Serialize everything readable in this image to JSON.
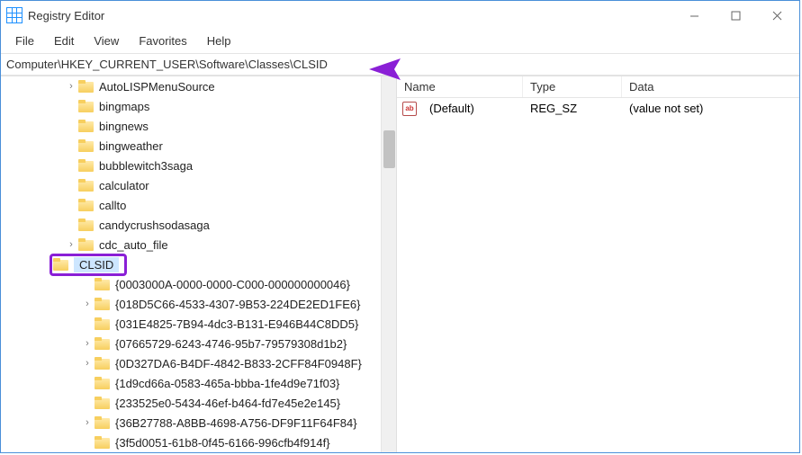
{
  "window": {
    "title": "Registry Editor"
  },
  "menu": {
    "file": "File",
    "edit": "Edit",
    "view": "View",
    "favorites": "Favorites",
    "help": "Help"
  },
  "address_path": "Computer\\HKEY_CURRENT_USER\\Software\\Classes\\CLSID",
  "tree": {
    "items": [
      {
        "label": "AutoLISPMenuSource",
        "indent": 72,
        "expander": ">"
      },
      {
        "label": "bingmaps",
        "indent": 72,
        "expander": ""
      },
      {
        "label": "bingnews",
        "indent": 72,
        "expander": ""
      },
      {
        "label": "bingweather",
        "indent": 72,
        "expander": ""
      },
      {
        "label": "bubblewitch3saga",
        "indent": 72,
        "expander": ""
      },
      {
        "label": "calculator",
        "indent": 72,
        "expander": ""
      },
      {
        "label": "callto",
        "indent": 72,
        "expander": ""
      },
      {
        "label": "candycrushsodasaga",
        "indent": 72,
        "expander": ""
      },
      {
        "label": "cdc_auto_file",
        "indent": 72,
        "expander": ">"
      }
    ],
    "selected": {
      "label": "CLSID",
      "indent": 58
    },
    "children": [
      {
        "label": "{0003000A-0000-0000-C000-000000000046}",
        "expander": ""
      },
      {
        "label": "{018D5C66-4533-4307-9B53-224DE2ED1FE6}",
        "expander": ">"
      },
      {
        "label": "{031E4825-7B94-4dc3-B131-E946B44C8DD5}",
        "expander": ""
      },
      {
        "label": "{07665729-6243-4746-95b7-79579308d1b2}",
        "expander": ">"
      },
      {
        "label": "{0D327DA6-B4DF-4842-B833-2CFF84F0948F}",
        "expander": ">"
      },
      {
        "label": "{1d9cd66a-0583-465a-bbba-1fe4d9e71f03}",
        "expander": ""
      },
      {
        "label": "{233525e0-5434-46ef-b464-fd7e45e2e145}",
        "expander": ""
      },
      {
        "label": "{36B27788-A8BB-4698-A756-DF9F11F64F84}",
        "expander": ">"
      },
      {
        "label": "{3f5d0051-61b8-0f45-6166-996cfb4f914f}",
        "expander": ""
      }
    ]
  },
  "list": {
    "headers": {
      "name": "Name",
      "type": "Type",
      "data": "Data"
    },
    "row": {
      "name": "(Default)",
      "type": "REG_SZ",
      "data": "(value not set)",
      "icon": "ab"
    }
  }
}
